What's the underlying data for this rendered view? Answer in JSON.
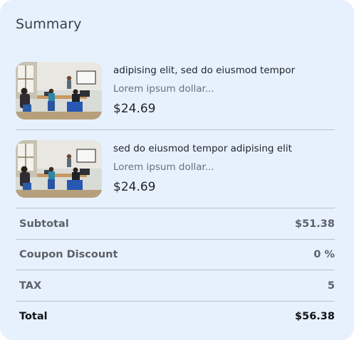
{
  "summary": {
    "title": "Summary",
    "items": [
      {
        "name": "adipising elit, sed do eiusmod tempor",
        "description": "Lorem ipsum dollar...",
        "price": "$24.69"
      },
      {
        "name": "sed do eiusmod tempor adipising elit",
        "description": "Lorem ipsum dollar...",
        "price": "$24.69"
      }
    ],
    "rows": {
      "subtotal": {
        "label": "Subtotal",
        "value": "$51.38"
      },
      "coupon": {
        "label": "Coupon Discount",
        "value": "0 %"
      },
      "tax": {
        "label": "TAX",
        "value": "5"
      },
      "total": {
        "label": "Total",
        "value": "$56.38"
      }
    }
  },
  "colors": {
    "card_background": "#e7f1fd",
    "divider": "#b9c0c8"
  }
}
